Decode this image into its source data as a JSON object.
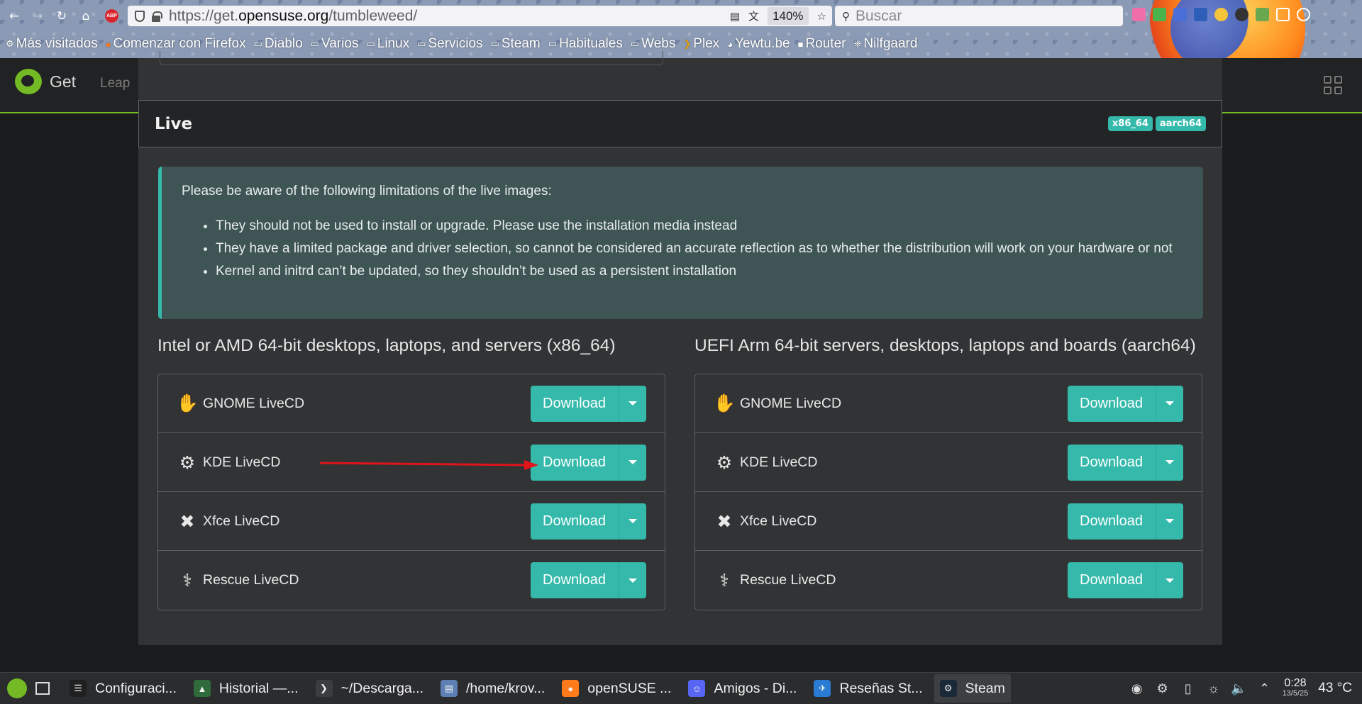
{
  "browser": {
    "url_prefix": "https://get.",
    "url_host": "opensuse.org",
    "url_path": "/tumbleweed/",
    "zoom": "140%",
    "search_placeholder": "Buscar",
    "abp_label": "ABP",
    "bookmarks": [
      {
        "label": "Más visitados",
        "icon": "gear-icon"
      },
      {
        "label": "Comenzar con Firefox",
        "icon": "firefox-icon"
      },
      {
        "label": "Diablo",
        "icon": "folder-icon"
      },
      {
        "label": "Varios",
        "icon": "folder-icon"
      },
      {
        "label": "Linux",
        "icon": "folder-icon"
      },
      {
        "label": "Servicios",
        "icon": "folder-icon"
      },
      {
        "label": "Steam",
        "icon": "folder-icon"
      },
      {
        "label": "Habituales",
        "icon": "folder-icon"
      },
      {
        "label": "Webs",
        "icon": "folder-icon"
      },
      {
        "label": "Plex",
        "icon": "plex-icon"
      },
      {
        "label": "Yewtu.be",
        "icon": "yewtu-icon"
      },
      {
        "label": "Router",
        "icon": "router-icon"
      },
      {
        "label": "Nilfgaard",
        "icon": "nilfgaard-icon"
      }
    ]
  },
  "site": {
    "brand": "Get",
    "nav_leap": "Leap"
  },
  "live": {
    "title": "Live",
    "arch_badges": [
      "x86_64",
      "aarch64"
    ],
    "notice_intro": "Please be aware of the following limitations of the live images:",
    "notice_items": [
      "They should not be used to install or upgrade. Please use the installation media instead",
      "They have a limited package and driver selection, so cannot be considered an accurate reflection as to whether the distribution will work on your hardware or not",
      "Kernel and initrd can’t be updated, so they shouldn’t be used as a persistent installation"
    ],
    "columns": [
      {
        "title": "Intel or AMD 64-bit desktops, laptops, and servers (x86_64)",
        "items": [
          {
            "label": "GNOME LiveCD",
            "icon": "gnome-icon",
            "button": "Download"
          },
          {
            "label": "KDE LiveCD",
            "icon": "kde-icon",
            "button": "Download"
          },
          {
            "label": "Xfce LiveCD",
            "icon": "xfce-icon",
            "button": "Download"
          },
          {
            "label": "Rescue LiveCD",
            "icon": "rescue-icon",
            "button": "Download"
          }
        ]
      },
      {
        "title": "UEFI Arm 64-bit servers, desktops, laptops and boards (aarch64)",
        "items": [
          {
            "label": "GNOME LiveCD",
            "icon": "gnome-icon",
            "button": "Download"
          },
          {
            "label": "KDE LiveCD",
            "icon": "kde-icon",
            "button": "Download"
          },
          {
            "label": "Xfce LiveCD",
            "icon": "xfce-icon",
            "button": "Download"
          },
          {
            "label": "Rescue LiveCD",
            "icon": "rescue-icon",
            "button": "Download"
          }
        ]
      }
    ]
  },
  "colors": {
    "accent": "#35b9ab",
    "opensuse_green": "#73ba25",
    "annotation_arrow": "#e0141a"
  },
  "taskbar": {
    "tasks": [
      {
        "label": "Configuraci...",
        "icon": "settings-icon"
      },
      {
        "label": "Historial —...",
        "icon": "system-monitor-icon"
      },
      {
        "label": "~/Descarga...",
        "icon": "terminal-icon"
      },
      {
        "label": "/home/krov...",
        "icon": "file-manager-icon"
      },
      {
        "label": "openSUSE ...",
        "icon": "firefox-icon"
      },
      {
        "label": "Amigos - Di...",
        "icon": "discord-icon"
      },
      {
        "label": "Reseñas St...",
        "icon": "steam-review-icon"
      },
      {
        "label": "Steam",
        "icon": "steam-icon"
      }
    ],
    "clock_time": "0:28",
    "clock_date": "13/5/25",
    "temperature": "43 °C"
  }
}
